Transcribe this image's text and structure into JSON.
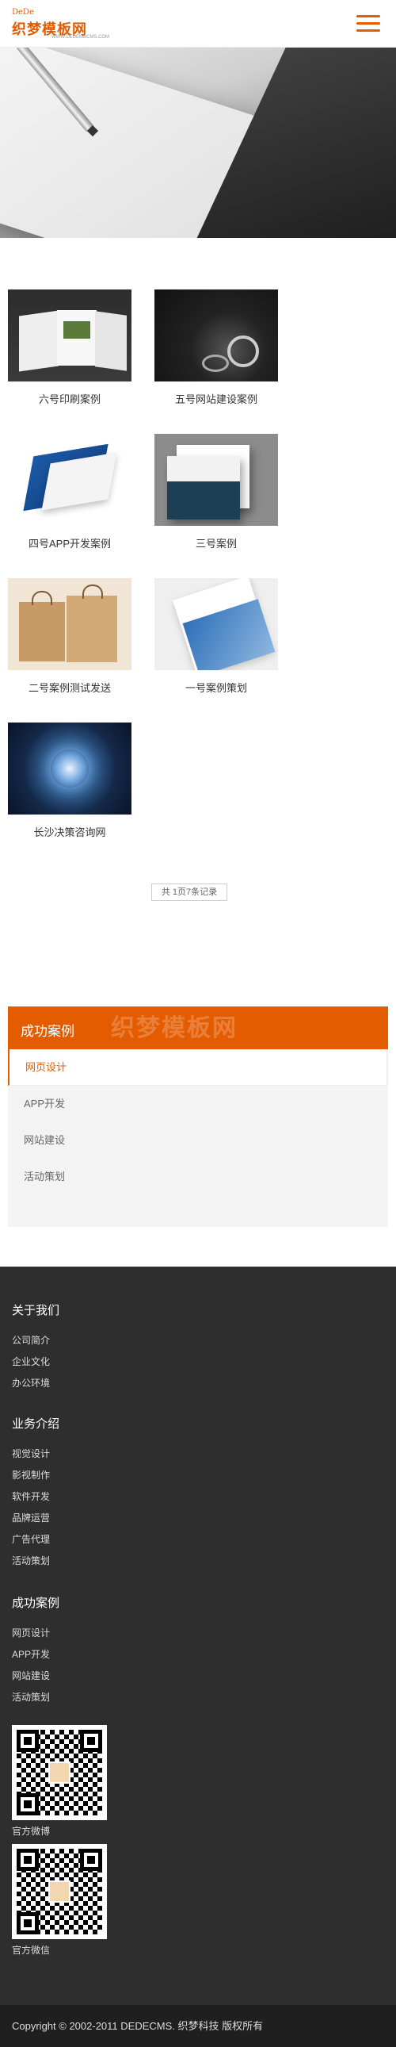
{
  "header": {
    "logo_top": "DeDe",
    "logo_main": "织梦模板网",
    "logo_url": "WWW.DEDEMBCMS.COM"
  },
  "cases": [
    {
      "title": "六号印刷案例"
    },
    {
      "title": "五号网站建设案例"
    },
    {
      "title": "四号APP开发案例"
    },
    {
      "title": "三号案例"
    },
    {
      "title": "二号案例测试发送"
    },
    {
      "title": "一号案例策划"
    },
    {
      "title": "长沙决策咨询网"
    }
  ],
  "pager": {
    "text": "共 1页7条记录"
  },
  "category": {
    "title": "成功案例",
    "watermark": "织梦模板网",
    "items": [
      "网页设计",
      "APP开发",
      "网站建设",
      "活动策划"
    ]
  },
  "footer": {
    "about": {
      "title": "关于我们",
      "links": [
        "公司简介",
        "企业文化",
        "办公环境"
      ]
    },
    "business": {
      "title": "业务介绍",
      "links": [
        "视觉设计",
        "影视制作",
        "软件开发",
        "品牌运营",
        "广告代理",
        "活动策划"
      ]
    },
    "cases": {
      "title": "成功案例",
      "links": [
        "网页设计",
        "APP开发",
        "网站建设",
        "活动策划"
      ]
    },
    "qr1_caption": "官方微博",
    "qr2_caption": "官方微信",
    "copyright": "Copyright © 2002-2011 DEDECMS. 织梦科技 版权所有"
  },
  "colors": {
    "accent": "#e35c00",
    "footer_bg": "#2e2e2e",
    "copyright_bg": "#1f1f1f"
  }
}
